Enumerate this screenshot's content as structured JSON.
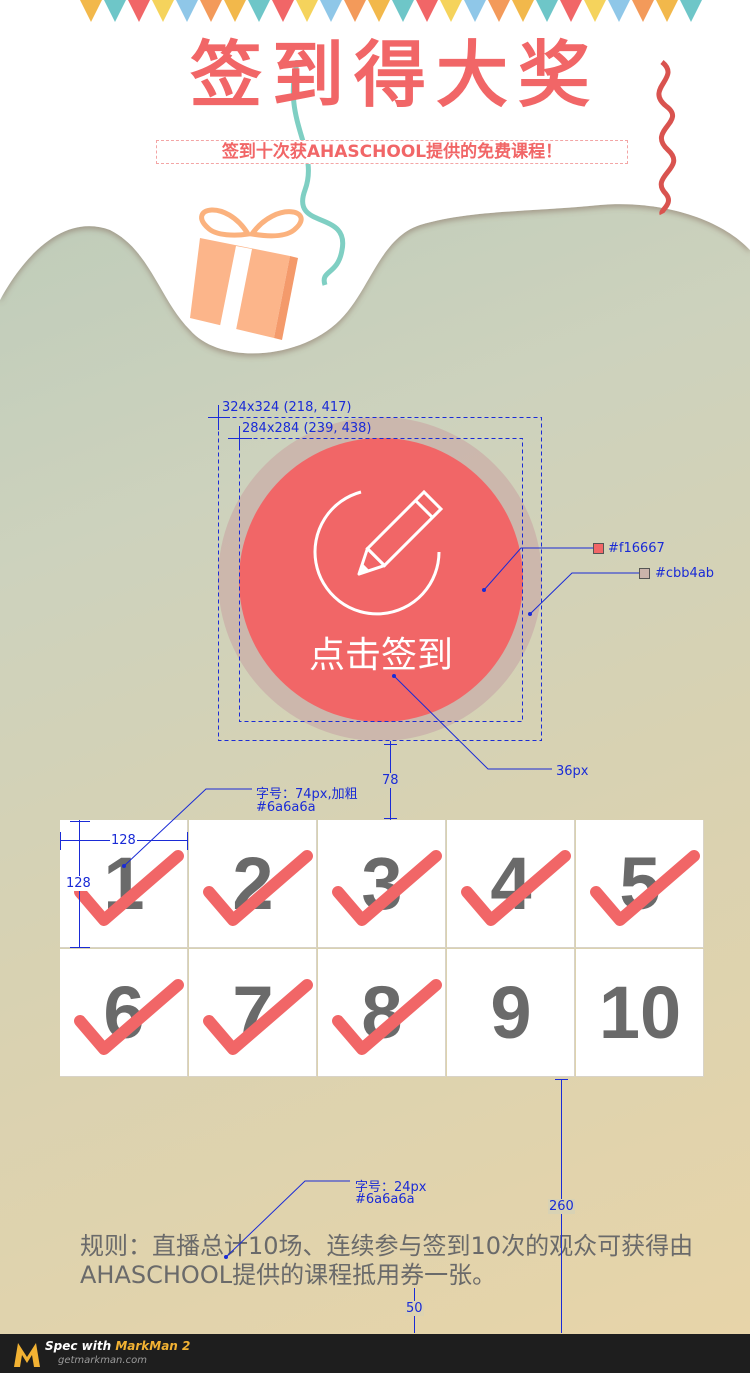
{
  "header": {
    "title": "签到得大奖",
    "subtitle": "签到十次获AHASCHOOL提供的免费课程！",
    "flag_colors": [
      "#f2b84b",
      "#6ec6c8",
      "#f16667",
      "#f5d35c",
      "#8fc7e8",
      "#f39a5a"
    ]
  },
  "signin_button": {
    "label": "点击签到",
    "icon": "pencil-icon",
    "inner_color": "#f16667",
    "outer_color": "#cbb4ab"
  },
  "checkin_grid": {
    "cells": [
      {
        "label": "1",
        "checked": true
      },
      {
        "label": "2",
        "checked": true
      },
      {
        "label": "3",
        "checked": true
      },
      {
        "label": "4",
        "checked": true
      },
      {
        "label": "5",
        "checked": true
      },
      {
        "label": "6",
        "checked": true
      },
      {
        "label": "7",
        "checked": true
      },
      {
        "label": "8",
        "checked": true
      },
      {
        "label": "9",
        "checked": false
      },
      {
        "label": "10",
        "checked": false
      }
    ],
    "check_color": "#f16667",
    "number_color": "#6a6a6a"
  },
  "rules": {
    "line1": "规则：直播总计10场、连续参与签到10次的观众可获得由",
    "line2": "AHASCHOOL提供的课程抵用券一张。"
  },
  "annotations": {
    "outer_size": "324x324 (218, 417)",
    "inner_size": "284x284 (239, 438)",
    "inner_color_label": "#f16667",
    "outer_color_label": "#cbb4ab",
    "button_font_size": "36px",
    "gap_78": "78",
    "num_font_line1": "字号：74px,加粗",
    "num_font_line2": "#6a6a6a",
    "cell_width": "128",
    "cell_height": "128",
    "rules_font_line1": "字号：24px",
    "rules_font_line2": "#6a6a6a",
    "gap_260": "260",
    "gap_50": "50"
  },
  "footer": {
    "brand_prefix": "Spec with",
    "brand_name": "MarkMan 2",
    "url": "getmarkman.com"
  }
}
